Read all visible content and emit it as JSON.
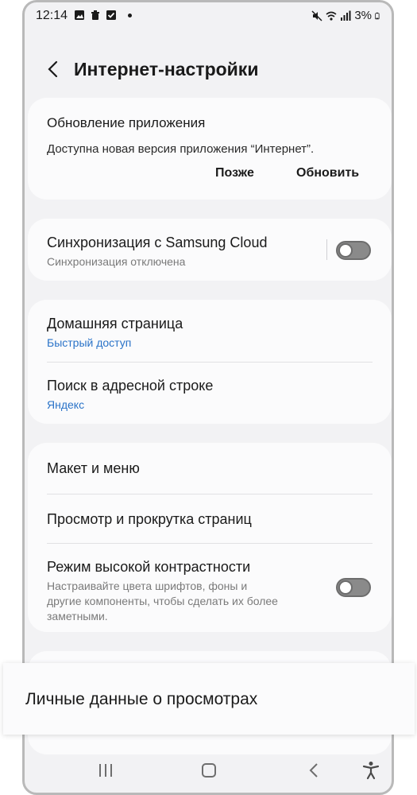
{
  "status": {
    "time": "12:14",
    "battery": "3%"
  },
  "header": {
    "title": "Интернет-настройки"
  },
  "update_card": {
    "title": "Обновление приложения",
    "text": "Доступна новая версия приложения “Интернет”.",
    "later_label": "Позже",
    "update_label": "Обновить"
  },
  "sync_card": {
    "title": "Синхронизация с Samsung Cloud",
    "subtitle": "Синхронизация отключена"
  },
  "home_card": {
    "home_title": "Домашняя страница",
    "home_sub": "Быстрый доступ",
    "search_title": "Поиск в адресной строке",
    "search_sub": "Яндекс"
  },
  "layout_card": {
    "layout_title": "Макет и меню",
    "browse_title": "Просмотр и прокрутка страниц",
    "contrast_title": "Режим высокой контрастности",
    "contrast_sub_1": "Настраивайте цвета шрифтов, фоны и",
    "contrast_sub_2": "другие компоненты, чтобы сделать их более",
    "contrast_sub_3": "заметными."
  },
  "popup": {
    "label": "Личные данные о просмотрах"
  },
  "colors": {
    "accent_blue": "#2a73c8",
    "background": "#f2f2f4",
    "card": "#fbfbfc"
  }
}
